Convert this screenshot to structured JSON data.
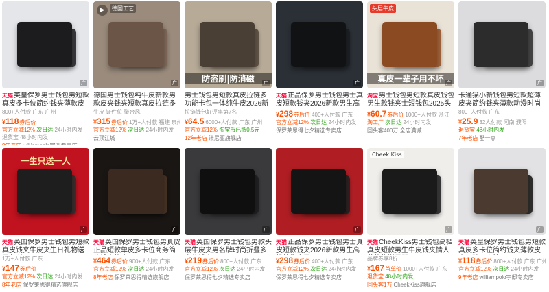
{
  "colors": {
    "accent": "#ff5000",
    "tmall": "#ff0036",
    "green": "#2aa515"
  },
  "products": [
    {
      "image": {
        "bg": "#e4e6ea",
        "wallet": "#1c1c1e",
        "wallet2": "#2b2b2e",
        "overlay": "",
        "corner": "",
        "corner_bg": "",
        "video": false
      },
      "badge": "天猫",
      "title": "英皇保罗男士钱包男短款真皮多卡位简约钱夹薄款皮夹驾驶证套拉",
      "meta": "800+人付款  广东 广州",
      "price": "118",
      "price_note": "券后价",
      "sold": "",
      "svc": [
        "官方立减12%",
        "次日达",
        "24小时内发"
      ],
      "extra": "退货宝   48小时内发",
      "shop_years": "9年老店",
      "shop": "williampolo宇邸专卖店"
    },
    {
      "image": {
        "bg": "#9a8b7c",
        "wallet": "#6b5546",
        "wallet2": "#7d6656",
        "overlay": "",
        "corner": "德国工艺",
        "corner_bg": "rgba(0,0,0,.35)",
        "video": true
      },
      "badge": "",
      "title": "德国男士钱包纯牛皮新款男款皮夹钱夹短款真皮拉链多功能卡包一体",
      "meta": "牛皮   证件位   聚合风",
      "price": "315",
      "price_note": "券后价",
      "sold": "1万+人付款  福建 泉州",
      "svc": [
        "官方立减12%",
        "次日达",
        "24小时内发"
      ],
      "extra": "",
      "shop_years": "",
      "shop": "云顶江城"
    },
    {
      "image": {
        "bg": "#b7aa97",
        "wallet": "#4a3f35",
        "wallet2": "#5a4d41",
        "overlay": "防盗刷|防消磁",
        "corner": "",
        "corner_bg": "",
        "video": false
      },
      "badge": "",
      "title": "男士钱包男短款真皮拉链多功能卡包一体纯牛皮2026新款",
      "meta": "拉链钱包好评率第7名",
      "price": "64.5",
      "price_note": "",
      "sold": "6000+人付款  广东 广州",
      "svc": [
        "官方立减12%",
        "淘宝币已抵0.5元"
      ],
      "extra": "",
      "shop_years": "12年老店",
      "shop": "法尼亚旗舰店"
    },
    {
      "image": {
        "bg": "#2b3036",
        "wallet": "#101214",
        "wallet2": "#1c1f22",
        "overlay": "",
        "corner": "",
        "corner_bg": "",
        "video": false
      },
      "badge": "天猫",
      "title": "正品保罗男士钱包男士真皮短款钱夹2026新款男生高级纯牛皮钱包",
      "meta": "",
      "price": "298",
      "price_note": "券后价",
      "sold": "400+人付款  广东",
      "svc": [
        "官方立减12%",
        "次日达",
        "24小时内发"
      ],
      "extra": "",
      "shop_years": "",
      "shop": "保罗莱思得七夕精选专卖店"
    },
    {
      "image": {
        "bg": "#e9e2d6",
        "wallet": "#8c4a22",
        "wallet2": "#9e5a2e",
        "overlay": "真皮一辈子用不坏",
        "corner": "头层牛皮",
        "corner_bg": "#e83a2a",
        "video": false
      },
      "badge": "淘宝",
      "title": "男士钱包男短款真皮钱包男生款钱夹士短钱包2025头层牛皮夹皮男",
      "meta": "",
      "price": "60.7",
      "price_note": "券后价",
      "sold": "1000+人付款  浙江",
      "svc": [
        "淘工厂",
        "次日达",
        "24小时内发"
      ],
      "extra": "",
      "shop_years": "",
      "shop": "回头客400万  全店满减"
    },
    {
      "image": {
        "bg": "#dcdcde",
        "wallet": "#2c2c2c",
        "wallet2": "#3a3a3a",
        "overlay": "",
        "corner": "",
        "corner_bg": "",
        "video": false
      },
      "badge": "",
      "title": "卡通猫小新钱包男短款超薄皮夹简约钱夹薄款动漫时尚潮牌",
      "meta": "800+人付款  广东",
      "price": "25.9",
      "price_note": "",
      "sold": "32人付款  河南 濮阳",
      "svc": [
        "退货宝",
        "48小时内发"
      ],
      "extra": "",
      "shop_years": "7年老店",
      "shop": "酷一点"
    },
    {
      "image": {
        "bg": "#c1121f",
        "wallet": "#1e1e1e",
        "wallet2": "#303030",
        "overlay": "一生只送一人",
        "corner": "",
        "corner_bg": "",
        "video": false
      },
      "badge": "天猫",
      "title": "英国保罗男士钱包男短款真皮钱夹牛皮夹生日礼物送男友老公",
      "meta": "1万+人付款  广东",
      "price": "147",
      "price_note": "券后价",
      "sold": "",
      "svc": [
        "官方立减12%",
        "次日达",
        "24小时内发"
      ],
      "extra": "",
      "shop_years": "8年老店",
      "shop": "保罗莱思得精选旗舰店"
    },
    {
      "image": {
        "bg": "#1a1614",
        "wallet": "#3a2a20",
        "wallet2": "#4a3526",
        "overlay": "",
        "corner": "",
        "corner_bg": "",
        "video": false
      },
      "badge": "天猫",
      "title": "英国保罗男士钱包男真皮正品短款单皮多卡位商务简约钱夹礼盒",
      "meta": "",
      "price": "464",
      "price_note": "券后价",
      "sold": "900+人付款  广东",
      "svc": [
        "官方立减12%",
        "次日达",
        "24小时内发"
      ],
      "extra": "",
      "shop_years": "8年老店",
      "shop": "保罗莱思得精选旗舰店"
    },
    {
      "image": {
        "bg": "#3a3a3c",
        "wallet": "#0f0f10",
        "wallet2": "#1e1e20",
        "overlay": "",
        "corner": "",
        "corner_bg": "",
        "video": false
      },
      "badge": "天猫",
      "title": "英国保罗男士钱包男款头层牛皮夹男名牌时尚折叠多卡位钱夹",
      "meta": "",
      "price": "219",
      "price_note": "券后价",
      "sold": "800+人付款  广东",
      "svc": [
        "官方立减12%",
        "次日达",
        "24小时内发"
      ],
      "extra": "",
      "shop_years": "",
      "shop": "保罗莱思得七夕精选专卖店"
    },
    {
      "image": {
        "bg": "#b01e23",
        "wallet": "#141414",
        "wallet2": "#222222",
        "overlay": "",
        "corner": "",
        "corner_bg": "",
        "video": false
      },
      "badge": "天猫",
      "title": "正品保罗男士钱包男士真皮短款钱夹2026新款男生高级纯牛皮男",
      "meta": "",
      "price": "298",
      "price_note": "券后价",
      "sold": "400+人付款  广东",
      "svc": [
        "官方立减12%",
        "次日达",
        "24小时内发"
      ],
      "extra": "",
      "shop_years": "",
      "shop": "保罗莱思得七夕精选专卖店"
    },
    {
      "image": {
        "bg": "#f0eeeb",
        "wallet": "#1a1a1a",
        "wallet2": "#2a2a2a",
        "overlay": "",
        "corner": "Cheek Kiss",
        "corner_bg": "rgba(255,255,255,.8)",
        "video": false
      },
      "badge": "天猫",
      "title": "CheekKiss男士钱包高档真皮短款男生牛皮钱夹情人节礼物送男朋",
      "meta": "品牌券享8折",
      "price": "167",
      "price_note": "首单价",
      "sold": "1000+人付款  广东",
      "svc": [
        "退货宝",
        "48小时内发"
      ],
      "extra": "",
      "shop_years": "回头客1万",
      "shop": "CheekKiss旗舰店"
    },
    {
      "image": {
        "bg": "#e2e2e4",
        "wallet": "#4a3a30",
        "wallet2": "#22201e",
        "overlay": "",
        "corner": "",
        "corner_bg": "",
        "video": false
      },
      "badge": "天猫",
      "title": "英皇保罗男士钱包男短款真皮多卡位简约钱夹薄款皮夹驾驶证套拉",
      "meta": "",
      "price": "118",
      "price_note": "券后价",
      "sold": "800+人付款  广东 广州",
      "svc": [
        "官方立减12%",
        "次日达",
        "24小时内发"
      ],
      "extra": "",
      "shop_years": "9年老店",
      "shop": "williampolo宇邸专卖店"
    }
  ]
}
